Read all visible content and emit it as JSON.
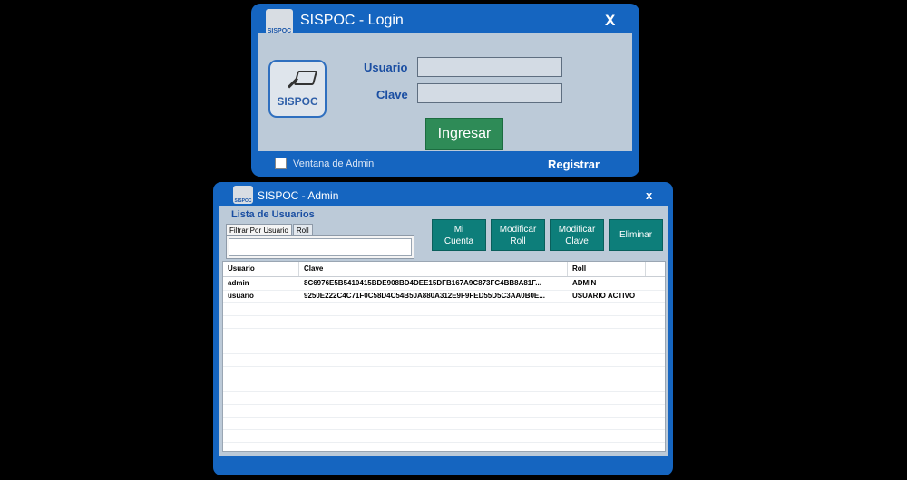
{
  "login": {
    "title": "SISPOC - Login",
    "close": "X",
    "logo_text": "SISPOC",
    "usuario_label": "Usuario",
    "clave_label": "Clave",
    "usuario_value": "",
    "clave_value": "",
    "ingresar_label": "Ingresar",
    "ventana_admin_label": "Ventana de Admin",
    "registrar_label": "Registrar"
  },
  "admin": {
    "title": "SISPOC - Admin",
    "close": "x",
    "logo_text": "SISPOC",
    "list_title": "Lista de Usuarios",
    "tabs": [
      "Filtrar Por Usuario",
      "Roll"
    ],
    "filter_value": "",
    "buttons": [
      "Mi\nCuenta",
      "Modificar\nRoll",
      "Modificar\nClave",
      "Eliminar"
    ],
    "columns": [
      "Usuario",
      "Clave",
      "Roll"
    ],
    "rows": [
      {
        "usuario": "admin",
        "clave": "8C6976E5B5410415BDE908BD4DEE15DFB167A9C873FC4BB8A81F...",
        "roll": "ADMIN"
      },
      {
        "usuario": "usuario",
        "clave": "9250E222C4C71F0C58D4C54B50A880A312E9F9FED55D5C3AA0B0E...",
        "roll": "USUARIO ACTIVO"
      }
    ]
  },
  "colors": {
    "window_blue": "#1565c0",
    "panel_bg": "#bccad8",
    "ingresar_green": "#2e8b57",
    "action_teal": "#0d7e7a",
    "label_blue": "#1a4ea2"
  }
}
